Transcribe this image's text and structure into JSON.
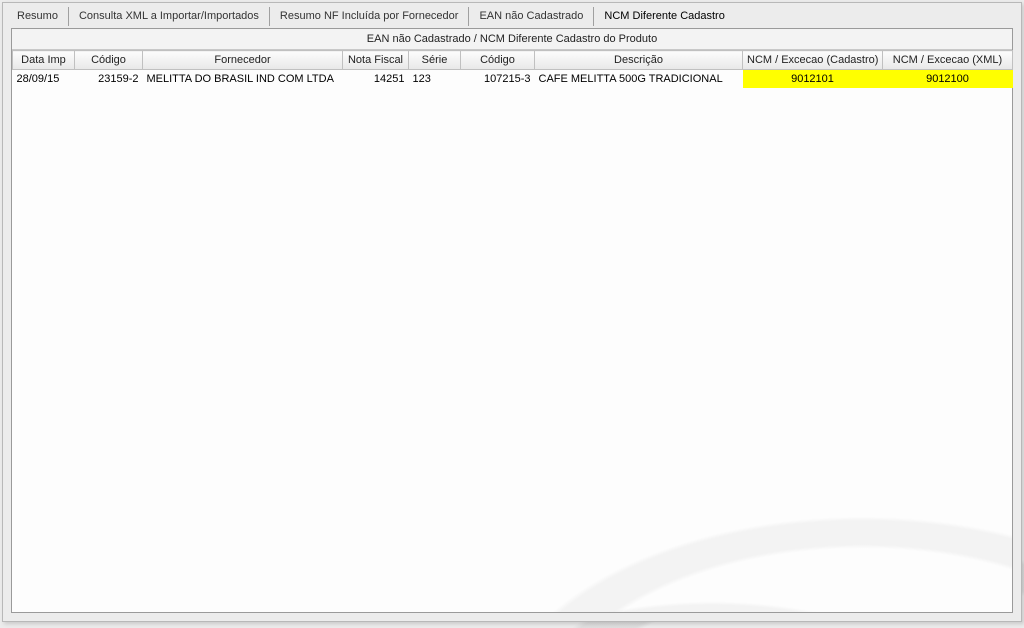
{
  "tabs": [
    {
      "label": "Resumo",
      "active": false
    },
    {
      "label": "Consulta XML a Importar/Importados",
      "active": false
    },
    {
      "label": "Resumo NF Incluída por Fornecedor",
      "active": false
    },
    {
      "label": "EAN não Cadastrado",
      "active": false
    },
    {
      "label": "NCM Diferente Cadastro",
      "active": true
    }
  ],
  "panel": {
    "title": "EAN não Cadastrado / NCM Diferente Cadastro do Produto",
    "columns": [
      "Data Imp",
      "Código",
      "Fornecedor",
      "Nota Fiscal",
      "Série",
      "Código",
      "Descrição",
      "NCM / Excecao (Cadastro)",
      "NCM / Excecao (XML)"
    ],
    "rows": [
      {
        "data_imp": "28/09/15",
        "codigo_forn": "23159-2",
        "fornecedor": "MELITTA DO BRASIL IND COM LTDA",
        "nota_fiscal": "14251",
        "serie": "123",
        "codigo_prod": "107215-3",
        "descricao": "CAFE MELITTA 500G TRADICIONAL",
        "ncm_cadastro": "9012101",
        "ncm_xml": "9012100"
      }
    ]
  }
}
